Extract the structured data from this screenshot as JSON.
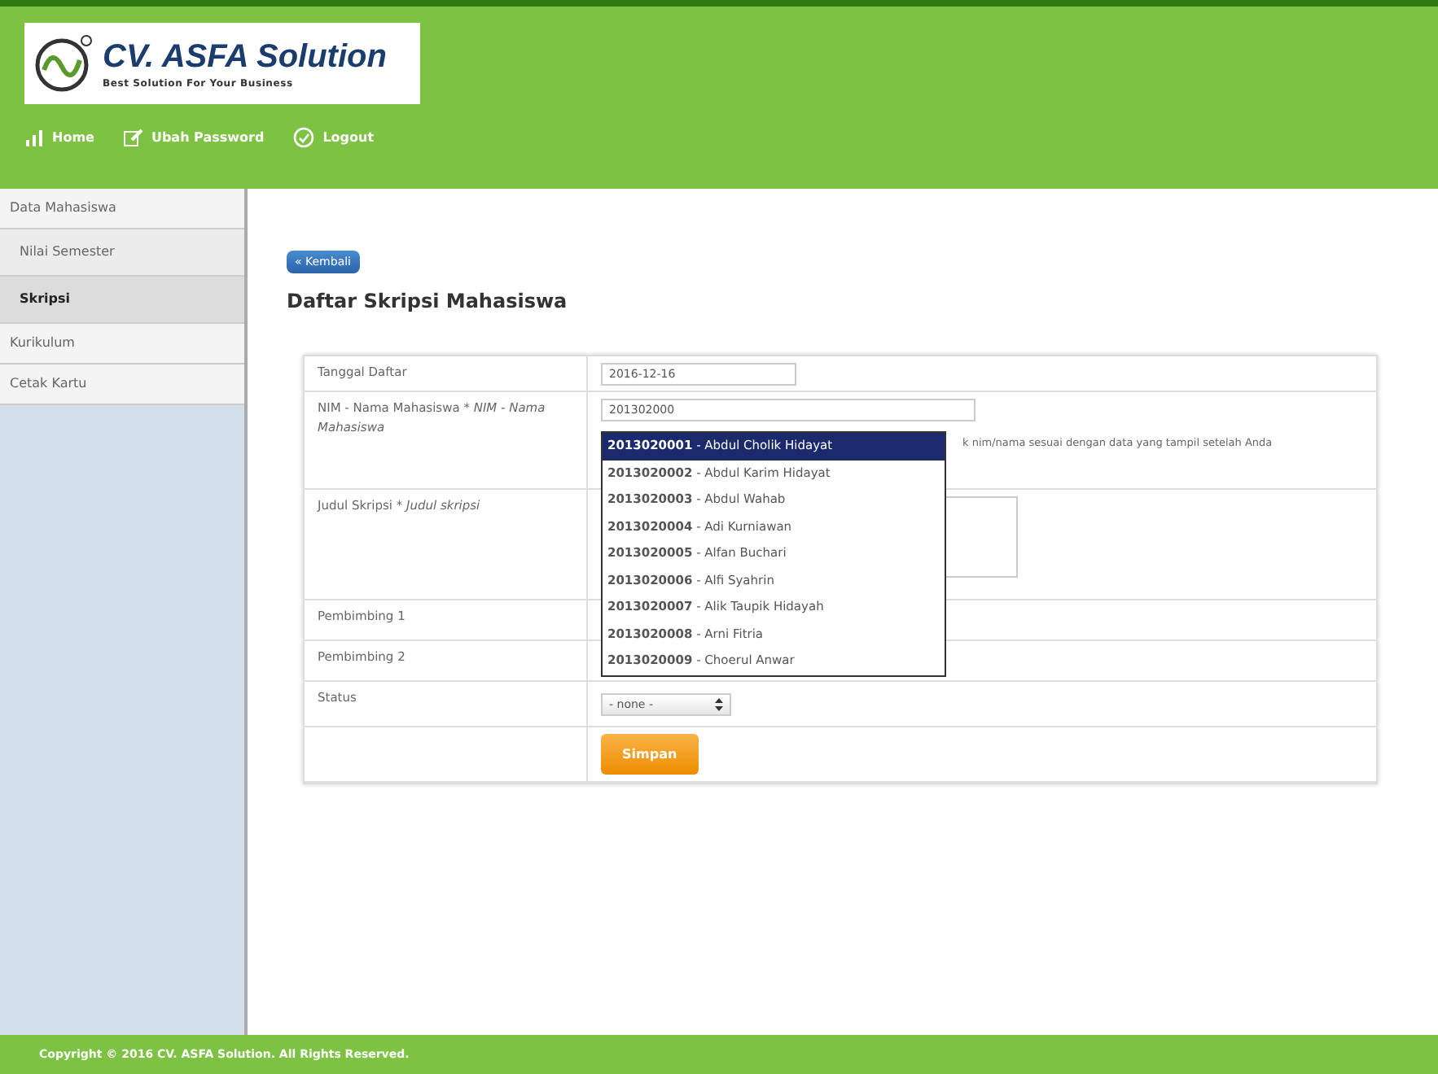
{
  "header": {
    "logo_title": "CV. ASFA Solution",
    "logo_tagline": "Best Solution For Your Business",
    "nav": [
      {
        "label": "Home"
      },
      {
        "label": "Ubah Password"
      },
      {
        "label": "Logout"
      }
    ]
  },
  "sidebar": {
    "items": [
      {
        "label": "Data Mahasiswa",
        "selected": false,
        "children": [
          {
            "label": "Nilai Semester",
            "selected": false
          },
          {
            "label": "Skripsi",
            "selected": true
          }
        ]
      },
      {
        "label": "Kurikulum",
        "selected": false
      },
      {
        "label": "Cetak Kartu",
        "selected": false
      }
    ]
  },
  "back_button": "« Kembali",
  "page_title": "Daftar Skripsi Mahasiswa",
  "form": {
    "rows": [
      {
        "kind": "text",
        "label": "Tanggal Daftar",
        "value": "2016-12-16"
      },
      {
        "kind": "autocomplete",
        "label": "NIM - Nama Mahasiswa * *NIM - Nama Mahasiswa*",
        "value": "201302000",
        "hint": "k nim/nama sesuai dengan data yang tampil setelah Anda"
      },
      {
        "kind": "textarea",
        "label": "Judul Skripsi * *Judul skripsi*"
      },
      {
        "kind": "empty",
        "label": "Pembimbing 1"
      },
      {
        "kind": "empty",
        "label": "Pembimbing 2"
      },
      {
        "kind": "select",
        "label": "Status",
        "value": "- none -"
      },
      {
        "kind": "submit",
        "label": "Simpan"
      }
    ]
  },
  "suggestions": [
    {
      "text": "**2013020001** - Abdul Cholik Hidayat",
      "selected": true
    },
    {
      "text": "**2013020002** - Abdul Karim Hidayat",
      "selected": false
    },
    {
      "text": "**2013020003** - Abdul Wahab",
      "selected": false
    },
    {
      "text": "**2013020004** - Adi Kurniawan",
      "selected": false
    },
    {
      "text": "**2013020005** - Alfan Buchari",
      "selected": false
    },
    {
      "text": "**2013020006** - Alfi Syahrin",
      "selected": false
    },
    {
      "text": "**2013020007** - Alik Taupik Hidayah",
      "selected": false
    },
    {
      "text": "**2013020008** - Arni Fitria",
      "selected": false
    },
    {
      "text": "**2013020009** - Choerul Anwar",
      "selected": false
    }
  ],
  "footer": "Copyright © 2016 CV. ASFA Solution. All Rights Reserved."
}
